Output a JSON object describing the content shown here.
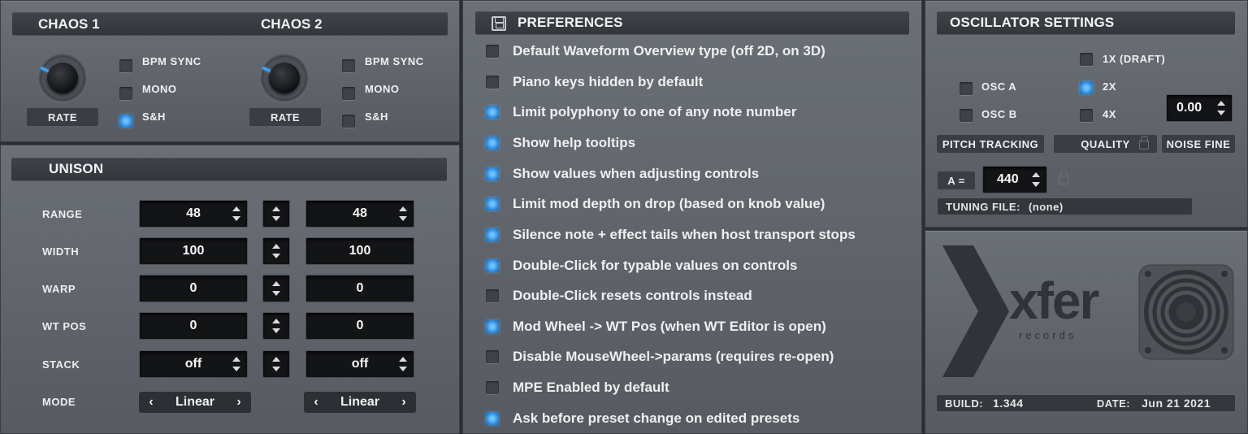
{
  "chaos1": {
    "title": "CHAOS 1",
    "knob_label": "RATE",
    "options": [
      {
        "label": "BPM SYNC",
        "checked": false
      },
      {
        "label": "MONO",
        "checked": false
      },
      {
        "label": "S&H",
        "checked": true
      }
    ]
  },
  "chaos2": {
    "title": "CHAOS 2",
    "knob_label": "RATE",
    "options": [
      {
        "label": "BPM SYNC",
        "checked": false
      },
      {
        "label": "MONO",
        "checked": false
      },
      {
        "label": "S&H",
        "checked": false
      }
    ]
  },
  "unison": {
    "title": "UNISON",
    "rows": [
      {
        "label": "RANGE",
        "left": "48",
        "right": "48"
      },
      {
        "label": "WIDTH",
        "left": "100",
        "right": "100"
      },
      {
        "label": "WARP",
        "left": "0",
        "right": "0"
      },
      {
        "label": "WT POS",
        "left": "0",
        "right": "0"
      },
      {
        "label": "STACK",
        "left": "off",
        "right": "off"
      }
    ],
    "mode": {
      "label": "MODE",
      "left": "Linear",
      "right": "Linear",
      "prev": "‹",
      "next": "›"
    }
  },
  "preferences": {
    "title": "PREFERENCES",
    "items": [
      {
        "label": "Default Waveform Overview type (off 2D, on 3D)",
        "checked": false
      },
      {
        "label": "Piano keys hidden by default",
        "checked": false
      },
      {
        "label": "Limit polyphony to one of any note number",
        "checked": true
      },
      {
        "label": "Show help tooltips",
        "checked": true
      },
      {
        "label": "Show values when adjusting controls",
        "checked": true
      },
      {
        "label": "Limit mod depth on drop (based on knob value)",
        "checked": true
      },
      {
        "label": "Silence note + effect tails when host transport stops",
        "checked": true
      },
      {
        "label": "Double-Click for typable values on controls",
        "checked": true
      },
      {
        "label": "Double-Click resets controls instead",
        "checked": false
      },
      {
        "label": "Mod Wheel -> WT Pos (when WT Editor is open)",
        "checked": true
      },
      {
        "label": "Disable MouseWheel->params (requires re-open)",
        "checked": false
      },
      {
        "label": "MPE Enabled by default",
        "checked": false
      },
      {
        "label": "Ask before preset change on edited presets",
        "checked": true
      }
    ]
  },
  "oscillator": {
    "title": "OSCILLATOR SETTINGS",
    "osc_a": {
      "label": "OSC A",
      "checked": false
    },
    "osc_b": {
      "label": "OSC B",
      "checked": false
    },
    "quality_options": [
      {
        "label": "1X (DRAFT)",
        "checked": false
      },
      {
        "label": "2X",
        "checked": true
      },
      {
        "label": "4X",
        "checked": false
      }
    ],
    "noise_fine_value": "0.00",
    "pitch_tracking_label": "PITCH TRACKING",
    "quality_label": "QUALITY",
    "noise_fine_label": "NOISE FINE",
    "a_label": "A =",
    "a_value": "440",
    "tuning_file_label": "TUNING FILE:",
    "tuning_file_value": "(none)"
  },
  "about": {
    "logo_text": "xfer",
    "logo_sub": "records",
    "build_label": "BUILD:",
    "build_value": "1.344",
    "date_label": "DATE:",
    "date_value": "Jun 21 2021"
  },
  "colors": {
    "accent": "#3ea7ff",
    "panel": "#62666c",
    "header": "#3a3d42",
    "field": "#131416"
  }
}
